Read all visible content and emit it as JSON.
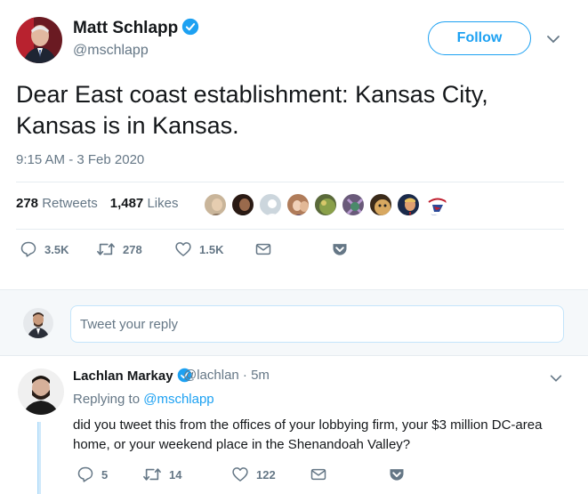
{
  "tweet": {
    "author_name": "Matt Schlapp",
    "author_handle": "@mschlapp",
    "follow_label": "Follow",
    "text": "Dear East coast establishment:  Kansas City, Kansas is in Kansas.",
    "timestamp": "9:15 AM - 3 Feb 2020",
    "retweets_count": "278",
    "retweets_label": "Retweets",
    "likes_count": "1,487",
    "likes_label": "Likes",
    "actions": {
      "replies": "3.5K",
      "retweets": "278",
      "likes": "1.5K"
    }
  },
  "reply_box": {
    "placeholder": "Tweet your reply"
  },
  "reply": {
    "author_name": "Lachlan Markay",
    "meta": "@lachlan · 5m",
    "replying_prefix": "Replying to",
    "replying_handle": "@mschlapp",
    "text": "did you tweet this from the offices of your lobbying firm, your $3 million DC-area home, or your weekend place in the Shenandoah Valley?",
    "actions": {
      "replies": "5",
      "retweets": "14",
      "likes": "122"
    }
  },
  "colors": {
    "accent": "#1da1f2",
    "muted": "#657786",
    "text": "#14171a"
  }
}
